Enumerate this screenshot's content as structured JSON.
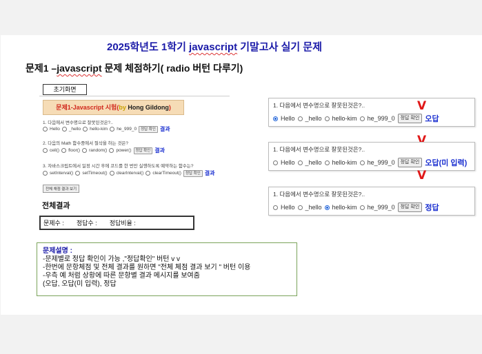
{
  "title": {
    "prefix": "2025학년도 1학기 ",
    "wavy": "javascript",
    "suffix": " 기말고사 실기 문제"
  },
  "subtitle": {
    "prefix": "문제1 –",
    "wavy": "javascript",
    "suffix": " 문제 체점하기( radio 버턴 다루기)"
  },
  "init_label": "초기화면",
  "mini": {
    "header": {
      "main": "문제1-Javascript 시험(",
      "by": "by ",
      "name": "Hong Gildong",
      "close": ")"
    },
    "questions": [
      {
        "q": "1. 다음에서 변수명으로 잘못된것은?..",
        "options": [
          "Hello",
          "_hello",
          "hello-kim",
          "he_999_0"
        ],
        "button": "정답 확인",
        "result": "결과"
      },
      {
        "q": "2. 다음의 Math 함수중에서 절삭을 하는 것은?",
        "options": [
          "ceil()",
          "floor()",
          "random()",
          "power()"
        ],
        "button": "정답 확인",
        "result": "결과"
      },
      {
        "q": "3. 자바스크립트에서 일정 시간 후에 코드를 한 번만 실행하도록 예약하는 함수는?",
        "options": [
          "setInterval()",
          "setTimeout()",
          "clearInterval()",
          "clearTimeout()"
        ],
        "button": "정답 확인",
        "result": "결과"
      }
    ],
    "total_button": "전체 채점 결과 보기",
    "total_title": "전체결과",
    "total_fields": [
      "문제수 :",
      "정답수 :",
      "정답비율 :"
    ]
  },
  "description": {
    "title": "문제설명 :",
    "lines": [
      "-문제별로 정답 확인이 가능 ,\"정답확인\" 버턴 v v",
      "-한번에 문항체점 및 전체 결과를 원하면 \"전체 체점 결과 보기 \" 버턴 이용",
      "-우측 예 처럼 상황에 따른 문항별 결과 메시지를 보여줌",
      "(오답, 오답(미 입력), 정답"
    ]
  },
  "panels": [
    {
      "q": "1. 다음에서 변수명으로 잘못된것은?..",
      "options": [
        "Hello",
        "_hello",
        "hello-kim",
        "he_999_0"
      ],
      "selected": 0,
      "button": "정답 확인",
      "result": "오답"
    },
    {
      "q": "1. 다음에서 변수명으로 잘못된것은?..",
      "options": [
        "Hello",
        "_hello",
        "hello-kim",
        "he_999_0"
      ],
      "selected": -1,
      "button": "정답 확인",
      "result": "오답(미 입력)"
    },
    {
      "q": "1. 다음에서 변수명으로 잘못된것은?..",
      "options": [
        "Hello",
        "_hello",
        "hello-kim",
        "he_999_0"
      ],
      "selected": 2,
      "button": "정답 확인",
      "result": "정답"
    }
  ],
  "marks": [
    "V",
    "V",
    "V"
  ],
  "colors": {
    "title": "#1a1aa8",
    "result": "#1a2fd0",
    "mark": "#e01818",
    "header_bg": "#f6dcb6"
  }
}
